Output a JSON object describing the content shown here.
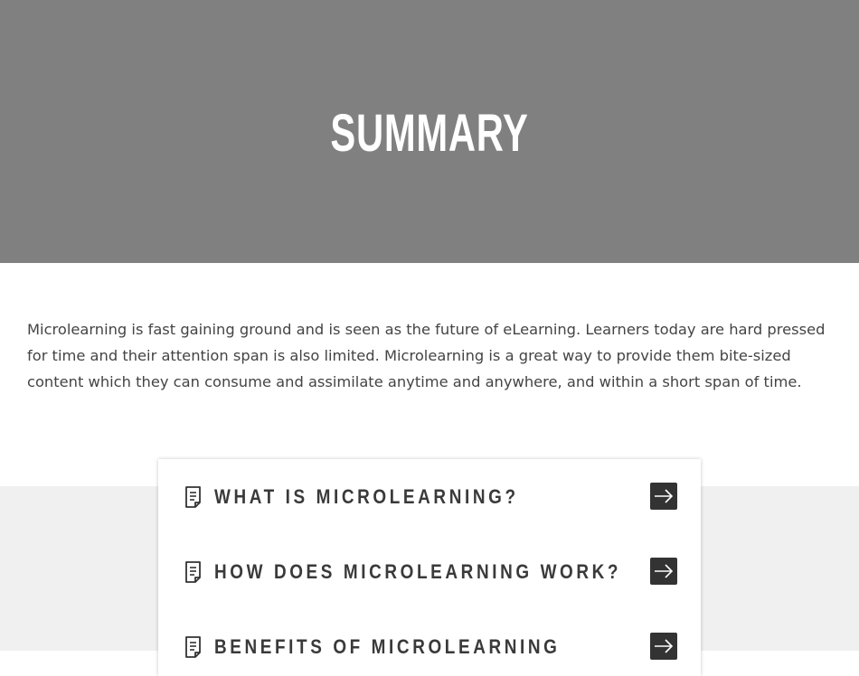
{
  "hero": {
    "title": "Summary",
    "background": "#808080"
  },
  "intro": {
    "text": "Microlearning is fast gaining ground and is seen as the future of eLearning. Learners today are hard pressed for time and their attention span is also limited. Microlearning is a great way to provide them bite-sized content which they can consume and assimilate anytime and anywhere, and within a short span of time."
  },
  "menu": {
    "items": [
      {
        "label": "What is Microlearning?",
        "icon": "document-icon",
        "action_icon": "arrow-right-icon"
      },
      {
        "label": "How does Microlearning work?",
        "icon": "document-icon",
        "action_icon": "arrow-right-icon"
      },
      {
        "label": "Benefits of Microlearning",
        "icon": "document-icon",
        "action_icon": "arrow-right-icon"
      }
    ]
  },
  "colors": {
    "band": "#f0f0f0",
    "button": "#333333",
    "label": "#3a3a3a"
  }
}
